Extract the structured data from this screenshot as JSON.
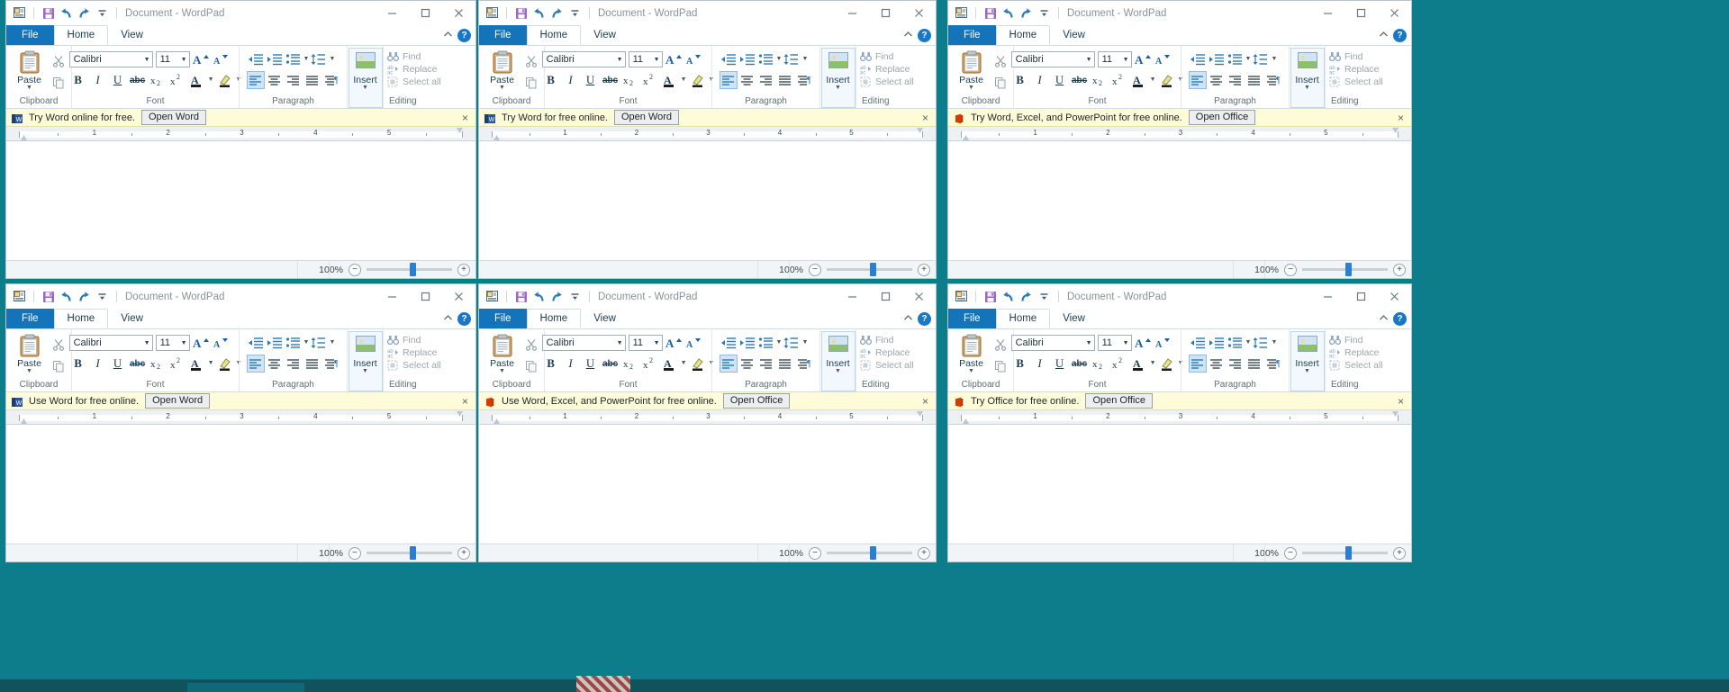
{
  "desktop": {
    "background": "#0d7d8c"
  },
  "common": {
    "title": "Document - WordPad",
    "tabs": {
      "file": "File",
      "home": "Home",
      "view": "View"
    },
    "qat": [
      "wordpad-doc-icon",
      "save-icon",
      "undo-icon",
      "redo-icon",
      "customize-qat-icon"
    ],
    "window_controls": {
      "minimize": "minimize-icon",
      "maximize": "maximize-icon",
      "close": "close-icon"
    },
    "ribbon_collapse": "chevron-up-icon",
    "help": "?",
    "groups": {
      "clipboard": "Clipboard",
      "font": "Font",
      "paragraph": "Paragraph",
      "editing": "Editing"
    },
    "clipboard": {
      "paste": "Paste",
      "cut": "cut-icon",
      "copy": "copy-icon"
    },
    "font": {
      "family": "Calibri",
      "size": "11",
      "grow": "A",
      "shrink": "A",
      "bold": "B",
      "italic": "I",
      "underline": "U",
      "strikethrough": "abc",
      "subscript": "x",
      "superscript": "x",
      "text_color": "A",
      "highlight": "highlighter-icon"
    },
    "paragraph": {
      "decrease_indent": "decrease-indent-icon",
      "increase_indent": "increase-indent-icon",
      "bullets": "bullets-icon",
      "line_spacing": "line-spacing-icon",
      "align_left": "align-left-icon",
      "align_center": "align-center-icon",
      "align_right": "align-right-icon",
      "justify": "justify-icon",
      "paragraph_marks": "paragraph-settings-icon"
    },
    "insert": {
      "label": "Insert",
      "icon": "insert-picture-icon"
    },
    "editing": {
      "find": "Find",
      "replace": "Replace",
      "select_all": "Select all"
    },
    "status": {
      "zoom_label": "100%",
      "zoom_out": "−",
      "zoom_in": "+"
    },
    "ruler": {
      "numbers": [
        "1",
        "2",
        "3",
        "4",
        "5"
      ]
    },
    "notif_close": "×"
  },
  "windows": [
    {
      "id": "window-1",
      "notification": {
        "text": "Try Word online for free.",
        "button": "Open Word",
        "icon": "word-icon",
        "icon_color": "#2b5797"
      }
    },
    {
      "id": "window-2",
      "notification": {
        "text": "Try Word for free online.",
        "button": "Open Word",
        "icon": "word-icon",
        "icon_color": "#2b5797"
      }
    },
    {
      "id": "window-3",
      "notification": {
        "text": "Try Word, Excel, and PowerPoint for free online.",
        "button": "Open Office",
        "icon": "office-icon",
        "icon_color": "#d83b01"
      }
    },
    {
      "id": "window-4",
      "notification": {
        "text": "Use Word for free online.",
        "button": "Open Word",
        "icon": "word-icon",
        "icon_color": "#2b5797"
      }
    },
    {
      "id": "window-5",
      "notification": {
        "text": "Use Word, Excel, and PowerPoint for free online.",
        "button": "Open Office",
        "icon": "office-icon",
        "icon_color": "#d83b01"
      }
    },
    {
      "id": "window-6",
      "notification": {
        "text": "Try Office for free online.",
        "button": "Open Office",
        "icon": "office-icon",
        "icon_color": "#d83b01"
      }
    }
  ]
}
